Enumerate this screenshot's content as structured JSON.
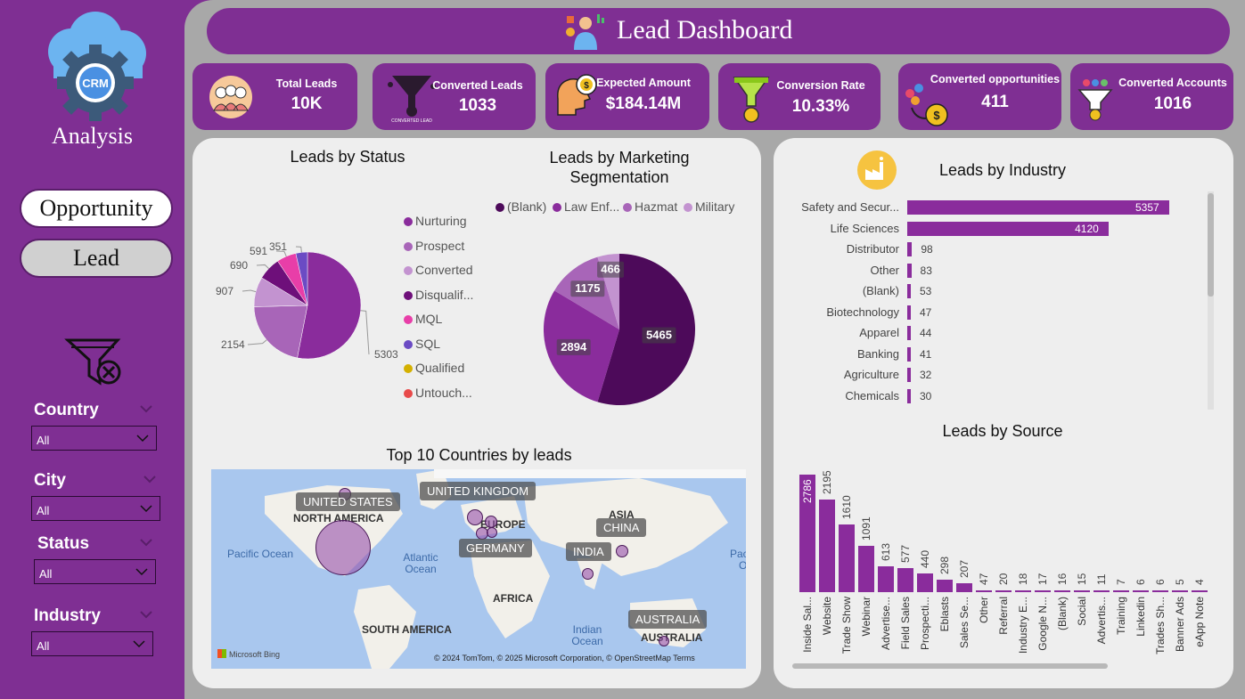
{
  "sidebar": {
    "logo_text": "CRM",
    "logo_caption": "Analysis",
    "nav": {
      "opportunity": "Opportunity",
      "lead": "Lead"
    },
    "slicers": [
      {
        "label": "Country",
        "value": "All"
      },
      {
        "label": "City",
        "value": "All"
      },
      {
        "label": "Status",
        "value": "All"
      },
      {
        "label": "Industry",
        "value": "All"
      }
    ]
  },
  "header": {
    "title": "Lead Dashboard"
  },
  "kpis": [
    {
      "title": "Total Leads",
      "value": "10K"
    },
    {
      "title": "Converted Leads",
      "value": "1033",
      "icon_caption": "CONVERTED LEAD"
    },
    {
      "title": "Expected Amount",
      "value": "$184.14M"
    },
    {
      "title": "Conversion Rate",
      "value": "10.33%"
    },
    {
      "title": "Converted opportunities",
      "value": "411"
    },
    {
      "title": "Converted Accounts",
      "value": "1016"
    }
  ],
  "colors": {
    "accent": "#7f2f93",
    "bar": "#8a2c9c",
    "panel": "#eeeeee",
    "main_bg": "#a8a8a8"
  },
  "map": {
    "title": "Top 10 Countries by leads",
    "tags": [
      "UNITED STATES",
      "UNITED KINGDOM",
      "GERMANY",
      "INDIA",
      "CHINA",
      "AUSTRALIA"
    ],
    "regions": [
      "NORTH AMERICA",
      "EUROPE",
      "ASIA",
      "AFRICA",
      "SOUTH AMERICA",
      "AUSTRALIA"
    ],
    "oceans": [
      "Pacific Ocean",
      "Atlantic Ocean",
      "Indian Ocean",
      "Pacific Oc"
    ],
    "attribution": "© 2024 TomTom, © 2025 Microsoft Corporation, © OpenStreetMap  Terms",
    "brand": "Microsoft Bing"
  },
  "chart_data": [
    {
      "type": "pie",
      "title": "Leads by Status",
      "categories": [
        "Nurturing",
        "Prospect",
        "Converted",
        "Disqualif...",
        "MQL",
        "SQL",
        "Qualified",
        "Untouch..."
      ],
      "values": [
        5303,
        2154,
        907,
        690,
        591,
        351
      ],
      "colors": [
        "#8a2c9c",
        "#a865b8",
        "#c393d0",
        "#6e0f7a",
        "#e83ea8",
        "#6b4bc4",
        "#d4b000",
        "#e84a4a"
      ]
    },
    {
      "type": "pie",
      "title": "Leads by Marketing Segmentation",
      "categories": [
        "(Blank)",
        "Law Enf...",
        "Hazmat",
        "Military"
      ],
      "values": [
        5465,
        2894,
        1175,
        466
      ],
      "colors": [
        "#4d0a5a",
        "#8a2c9c",
        "#a865b8",
        "#c393d0"
      ]
    },
    {
      "type": "bar",
      "title": "Leads by Industry",
      "categories": [
        "Safety and Secur...",
        "Life Sciences",
        "Distributor",
        "Other",
        "(Blank)",
        "Biotechnology",
        "Apparel",
        "Banking",
        "Agriculture",
        "Chemicals"
      ],
      "values": [
        5357,
        4120,
        98,
        83,
        53,
        47,
        44,
        41,
        32,
        30
      ]
    },
    {
      "type": "bar",
      "title": "Leads by Source",
      "categories": [
        "Inside Sal...",
        "Website",
        "Trade Show",
        "Webinar",
        "Advertise...",
        "Field Sales",
        "Prospecti...",
        "Eblasts",
        "Sales Se...",
        "Other",
        "Referral",
        "Industry E...",
        "Google N...",
        "(Blank)",
        "Social",
        "Advertis...",
        "Training",
        "Linkedin",
        "Trades Sh...",
        "Banner Ads",
        "eApp Note"
      ],
      "values": [
        2786,
        2195,
        1610,
        1091,
        613,
        577,
        440,
        298,
        207,
        47,
        20,
        18,
        17,
        16,
        15,
        11,
        7,
        6,
        6,
        5,
        4
      ]
    }
  ]
}
